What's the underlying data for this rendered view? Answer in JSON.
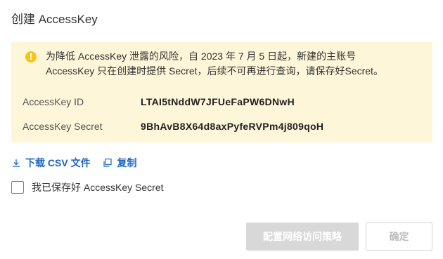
{
  "dialog": {
    "title": "创建 AccessKey"
  },
  "notice": {
    "icon": "warning-icon",
    "icon_color": "#f5c518",
    "background": "#fdf6d9",
    "line1": "为降低 AccessKey 泄露的风险，自 2023 年 7 月 5 日起，新建的主账号",
    "line2": "AccessKey 只在创建时提供 Secret，后续不可再进行查询，请保存好Secret。",
    "fields": [
      {
        "label": "AccessKey ID",
        "value": "LTAI5tNddW7JFUeFaPW6DNwH"
      },
      {
        "label": "AccessKey Secret",
        "value": "9BhAvB8X64d8axPyfeRVPm4j809qoH"
      }
    ]
  },
  "actions": {
    "download_label": "下载 CSV 文件",
    "copy_label": "复制",
    "link_color": "#1f66c1"
  },
  "confirm_checkbox": {
    "label": "我已保存好 AccessKey Secret",
    "checked": false
  },
  "footer": {
    "configure_policy_label": "配置网络访问策略",
    "ok_label": "确定"
  }
}
